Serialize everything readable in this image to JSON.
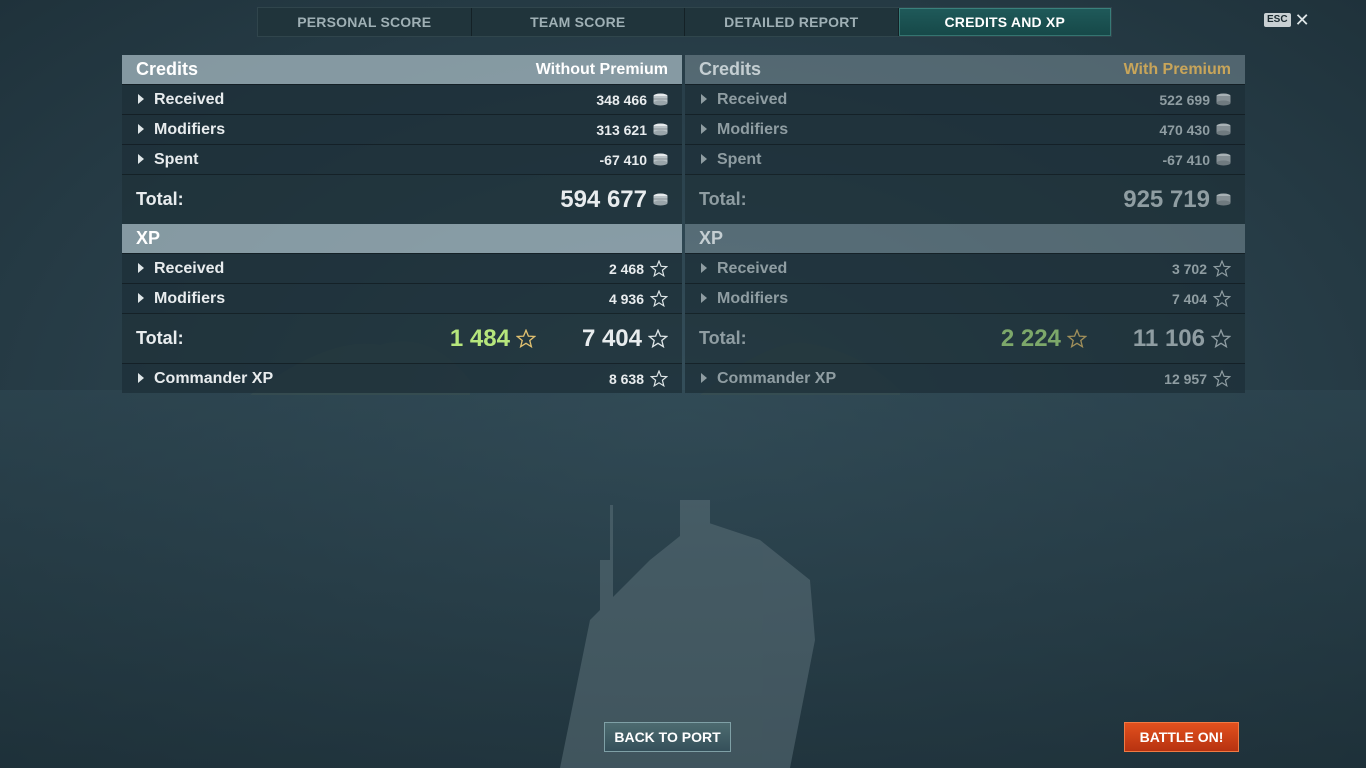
{
  "tabs": [
    {
      "label": "PERSONAL SCORE"
    },
    {
      "label": "TEAM SCORE"
    },
    {
      "label": "DETAILED REPORT"
    },
    {
      "label": "CREDITS AND XP"
    }
  ],
  "active_tab": "CREDITS AND XP",
  "esc_label": "ESC",
  "close_glyph": "✕",
  "without_premium": {
    "credits": {
      "title": "Credits",
      "column_label": "Without Premium",
      "rows": [
        {
          "label": "Received",
          "value": "348 466"
        },
        {
          "label": "Modifiers",
          "value": "313 621"
        },
        {
          "label": "Spent",
          "value": "-67 410"
        }
      ],
      "total_label": "Total:",
      "total_value": "594 677"
    },
    "xp": {
      "title": "XP",
      "rows": [
        {
          "label": "Received",
          "value": "2 468"
        },
        {
          "label": "Modifiers",
          "value": "4 936"
        }
      ],
      "total_label": "Total:",
      "total_free_xp": "1 484",
      "total_value": "7 404",
      "commander_label": "Commander XP",
      "commander_value": "8 638"
    }
  },
  "with_premium": {
    "credits": {
      "title": "Credits",
      "column_label": "With Premium",
      "rows": [
        {
          "label": "Received",
          "value": "522 699"
        },
        {
          "label": "Modifiers",
          "value": "470 430"
        },
        {
          "label": "Spent",
          "value": "-67 410"
        }
      ],
      "total_label": "Total:",
      "total_value": "925 719"
    },
    "xp": {
      "title": "XP",
      "rows": [
        {
          "label": "Received",
          "value": "3 702"
        },
        {
          "label": "Modifiers",
          "value": "7 404"
        }
      ],
      "total_label": "Total:",
      "total_free_xp": "2 224",
      "total_value": "11 106",
      "commander_label": "Commander XP",
      "commander_value": "12 957"
    }
  },
  "buttons": {
    "back_to_port": "BACK TO PORT",
    "battle_on": "BATTLE ON!"
  },
  "colors": {
    "premium": "#c8a55a",
    "free_xp": "#b6e67c",
    "battle_button": "#d0431a",
    "active_tab": "#1f5a5a"
  },
  "icons": {
    "credits": "coin-stack-icon",
    "xp": "star-icon",
    "expand": "caret-right-icon"
  }
}
